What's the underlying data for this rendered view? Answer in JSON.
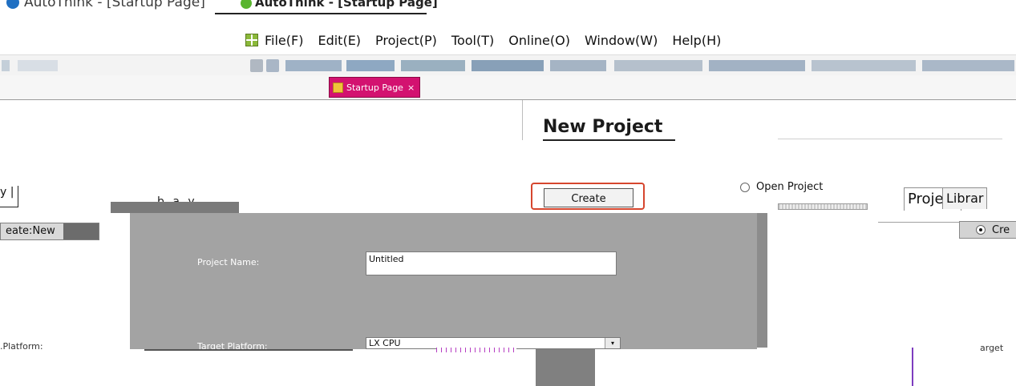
{
  "window": {
    "background_title": "AutoThink - [Startup Page]",
    "foreground_title": "AutoThink - [Startup Page]"
  },
  "menu": {
    "items": [
      "File(F)",
      "Edit(E)",
      "Project(P)",
      "Tool(T)",
      "Online(O)",
      "Window(W)",
      "Help(H)"
    ]
  },
  "tabs": {
    "startup_label": "Startup Page",
    "close_glyph": "×"
  },
  "startup": {
    "heading": "New Project",
    "create_button": "Create",
    "open_project_label": "Open Project",
    "create_new_fragment": "eate:New",
    "library_fragment": "_b a y_",
    "left_selector_fragment": "y |",
    "project_tab": "Project",
    "library_tab": "Librar",
    "create_radio_fragment": "Cre"
  },
  "dialog": {
    "project_name_label": "Project Name:",
    "project_name_value": "Untitled",
    "target_platform_label": "Target Platform:",
    "target_platform_value": "LX CPU",
    "dropdown_glyph": "▾"
  },
  "fragments": {
    "platform_left": ".Platform:",
    "target_right": "arget"
  },
  "colors": {
    "tab_active": "#d31270",
    "create_highlight": "#d6462e",
    "dialog_gray": "#a3a3a3"
  }
}
